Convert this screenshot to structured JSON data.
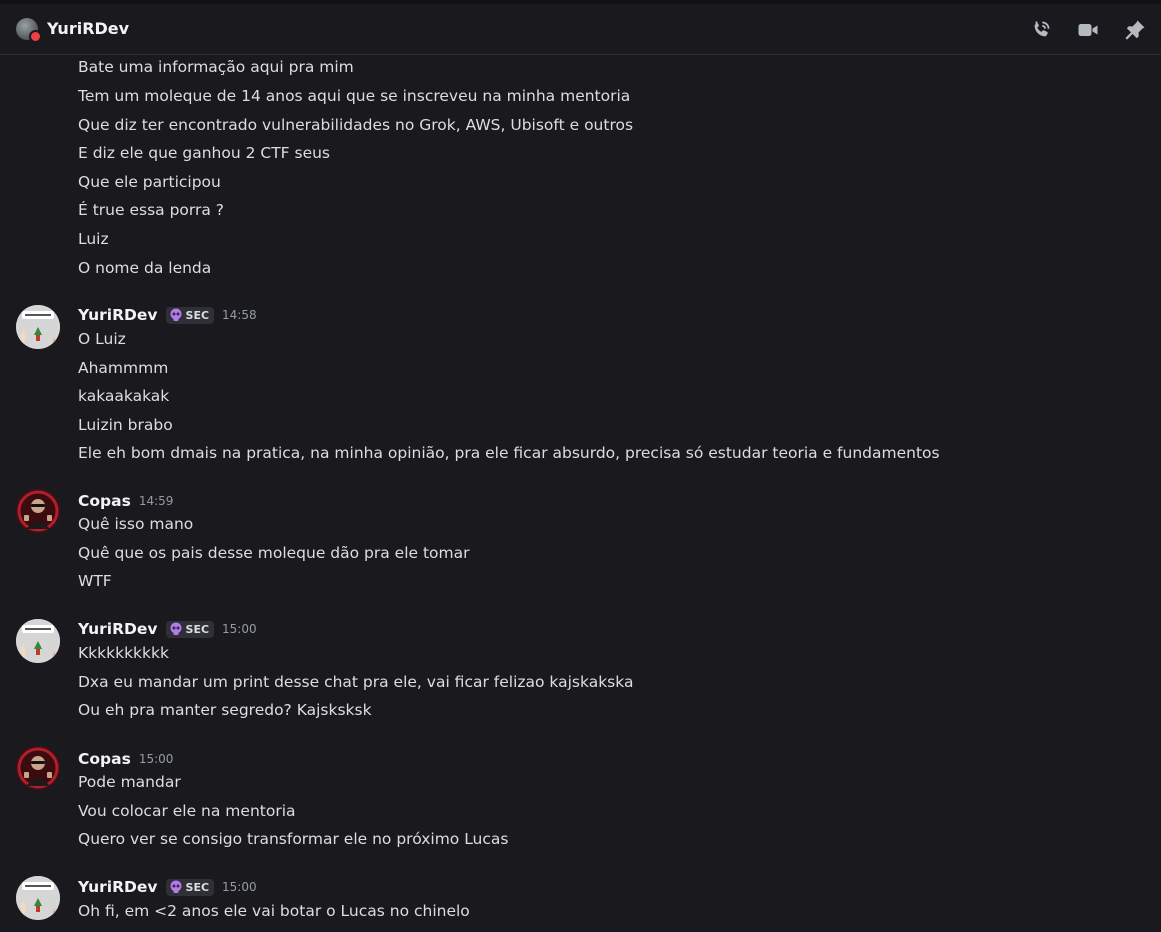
{
  "header": {
    "title": "YuriRDev",
    "icons": [
      "phone-call-icon",
      "video-camera-icon",
      "pin-icon"
    ]
  },
  "colors": {
    "background": "#1a1a1e",
    "status_dnd": "#f23f43",
    "tag_background": "#2e3035",
    "tag_icon": "#b57bee"
  },
  "continued_lines": [
    "Bate uma informação aqui pra mim",
    "Tem um moleque de 14 anos aqui que se inscreveu na minha mentoria",
    "Que diz ter encontrado vulnerabilidades no Grok, AWS, Ubisoft e outros",
    "E diz ele que ganhou 2 CTF seus",
    "Que ele participou",
    "É true essa porra ?",
    "Luiz",
    "O nome da lenda"
  ],
  "messages": [
    {
      "author": "YuriRDev",
      "tag": "SEC",
      "time": "14:58",
      "lines": [
        "O Luiz",
        "Ahammmm",
        "kakaakakak",
        "Luizin brabo",
        "Ele eh bom dmais na pratica, na minha opinião, pra ele ficar absurdo, precisa só estudar teoria e fundamentos"
      ]
    },
    {
      "author": "Copas",
      "time": "14:59",
      "lines": [
        "Quê isso mano",
        "Quê que os pais desse moleque dão pra ele tomar",
        "WTF"
      ]
    },
    {
      "author": "YuriRDev",
      "tag": "SEC",
      "time": "15:00",
      "lines": [
        "Kkkkkkkkkk",
        "Dxa eu mandar um print desse chat pra ele, vai ficar felizao kajskakska",
        "Ou eh pra manter segredo? Kajsksksk"
      ]
    },
    {
      "author": "Copas",
      "time": "15:00",
      "lines": [
        "Pode mandar",
        "Vou colocar ele na mentoria",
        "Quero ver se consigo transformar ele no próximo Lucas"
      ]
    },
    {
      "author": "YuriRDev",
      "tag": "SEC",
      "time": "15:00",
      "lines": [
        "Oh fi, em <2 anos ele vai botar o Lucas no chinelo"
      ]
    }
  ]
}
